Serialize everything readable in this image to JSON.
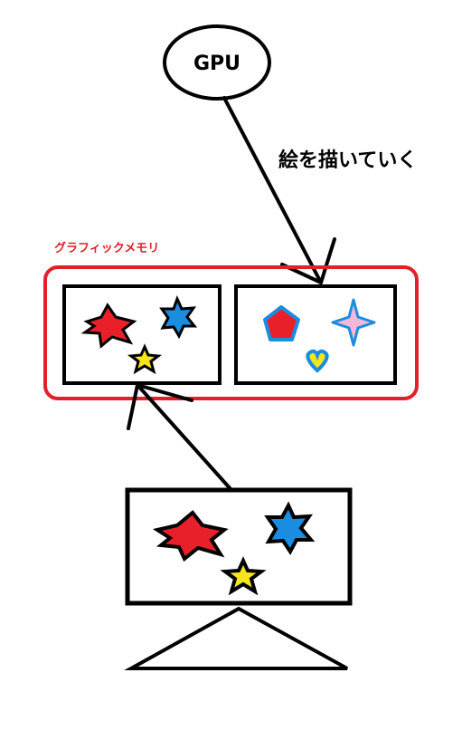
{
  "gpu": {
    "label": "GPU"
  },
  "draw_label": "絵を描いていく",
  "graphics_memory": {
    "label": "グラフィックメモリ",
    "frame_color": "#e0202a"
  },
  "colors": {
    "outline": "#000000",
    "red": "#e8202a",
    "blue": "#1a8de0",
    "yellow": "#f5e61c",
    "pink": "#f4b8d8",
    "light_blue": "#1a8de0"
  },
  "icons": {
    "front_buffer_shapes": [
      "red-star-icon",
      "blue-star-icon",
      "yellow-star-icon"
    ],
    "back_buffer_shapes": [
      "red-pentagon-icon",
      "pink-sparkle-icon",
      "yellow-heart-icon"
    ],
    "monitor_shapes": [
      "red-star-icon",
      "blue-star-icon",
      "yellow-star-icon"
    ]
  }
}
